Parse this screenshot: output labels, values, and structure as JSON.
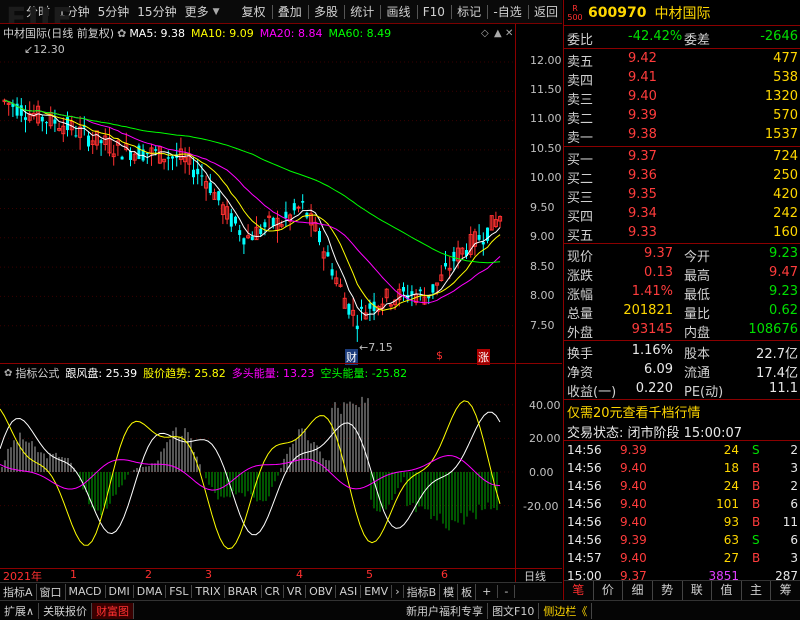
{
  "toolbar": {
    "items": [
      "分时",
      "1分钟",
      "5分钟",
      "15分钟",
      "更多",
      "复权",
      "叠加",
      "多股",
      "统计",
      "画线",
      "F10",
      "标记",
      "-自选",
      "返回"
    ]
  },
  "main_title": {
    "name": "中材国际(日线 前复权)",
    "ma5": "MA5: 9.38",
    "ma10": "MA10: 9.09",
    "ma20": "MA20: 8.84",
    "ma60": "MA60: 8.49"
  },
  "colors": {
    "ma5": "#ffffff",
    "ma10": "#ffff00",
    "ma20": "#ff00ff",
    "ma60": "#00ff00",
    "up": "#ff3030",
    "down": "#00ffff"
  },
  "price_axis": [
    "12.00",
    "11.50",
    "11.00",
    "10.50",
    "10.00",
    "9.50",
    "9.00",
    "8.50",
    "8.00",
    "7.50"
  ],
  "high_label": "12.30",
  "low_label": "7.15",
  "markers": {
    "cai": "财",
    "s": "$",
    "zhang": "涨"
  },
  "indicator": {
    "name": "指标公式",
    "a": "跟风盘: 25.39",
    "b": "股价趋势: 25.82",
    "c": "多头能量: 13.23",
    "d": "空头能量: -25.82"
  },
  "ind_axis": [
    "40.00",
    "20.00",
    "0.00",
    "-20.00"
  ],
  "dates": [
    "2021年",
    "1",
    "2",
    "3",
    "4",
    "5",
    "6"
  ],
  "date_right": "日线",
  "bottom_tabs": [
    "指标A",
    "窗口",
    "MACD",
    "DMI",
    "DMA",
    "FSL",
    "TRIX",
    "BRAR",
    "CR",
    "VR",
    "OBV",
    "ASI",
    "EMV",
    "指标B",
    "模",
    "板",
    "+",
    "-"
  ],
  "bottom2": [
    "扩展∧",
    "关联报价",
    "财富图",
    "新用户福利专享",
    "图文F10",
    "侧边栏《"
  ],
  "right": {
    "code": "600970",
    "name": "中材国际",
    "badge": "R",
    "badge2": "500",
    "weibi_lbl": "委比",
    "weibi": "-42.42%",
    "weicha_lbl": "委差",
    "weicha": "-2646",
    "asks": [
      {
        "l": "卖五",
        "p": "9.42",
        "v": "477"
      },
      {
        "l": "卖四",
        "p": "9.41",
        "v": "538"
      },
      {
        "l": "卖三",
        "p": "9.40",
        "v": "1320"
      },
      {
        "l": "卖二",
        "p": "9.39",
        "v": "570"
      },
      {
        "l": "卖一",
        "p": "9.38",
        "v": "1537"
      }
    ],
    "bids": [
      {
        "l": "买一",
        "p": "9.37",
        "v": "724"
      },
      {
        "l": "买二",
        "p": "9.36",
        "v": "250"
      },
      {
        "l": "买三",
        "p": "9.35",
        "v": "420"
      },
      {
        "l": "买四",
        "p": "9.34",
        "v": "242"
      },
      {
        "l": "买五",
        "p": "9.33",
        "v": "160"
      }
    ],
    "stats": [
      {
        "l1": "现价",
        "v1": "9.37",
        "c1": "red",
        "l2": "今开",
        "v2": "9.23",
        "c2": "grn"
      },
      {
        "l1": "涨跌",
        "v1": "0.13",
        "c1": "red",
        "l2": "最高",
        "v2": "9.47",
        "c2": "red"
      },
      {
        "l1": "涨幅",
        "v1": "1.41%",
        "c1": "red",
        "l2": "最低",
        "v2": "9.23",
        "c2": "grn"
      },
      {
        "l1": "总量",
        "v1": "201821",
        "c1": "yel",
        "l2": "量比",
        "v2": "0.62",
        "c2": "grn"
      },
      {
        "l1": "外盘",
        "v1": "93145",
        "c1": "red",
        "l2": "内盘",
        "v2": "108676",
        "c2": "grn"
      }
    ],
    "stats2": [
      {
        "l1": "换手",
        "v1": "1.16%",
        "l2": "股本",
        "v2": "22.7亿"
      },
      {
        "l1": "净资",
        "v1": "6.09",
        "l2": "流通",
        "v2": "17.4亿"
      },
      {
        "l1": "收益(一)",
        "v1": "0.220",
        "l2": "PE(动)",
        "v2": "11.1"
      }
    ],
    "promo": "仅需20元查看千档行情",
    "status": "交易状态: 闭市阶段 15:00:07",
    "ticks": [
      {
        "t": "14:56",
        "p": "9.39",
        "v": "24",
        "d": "S",
        "n": "2"
      },
      {
        "t": "14:56",
        "p": "9.40",
        "v": "18",
        "d": "B",
        "n": "3"
      },
      {
        "t": "14:56",
        "p": "9.40",
        "v": "24",
        "d": "B",
        "n": "2"
      },
      {
        "t": "14:56",
        "p": "9.40",
        "v": "101",
        "d": "B",
        "n": "6"
      },
      {
        "t": "14:56",
        "p": "9.40",
        "v": "93",
        "d": "B",
        "n": "11"
      },
      {
        "t": "14:56",
        "p": "9.39",
        "v": "63",
        "d": "S",
        "n": "6"
      },
      {
        "t": "14:57",
        "p": "9.40",
        "v": "27",
        "d": "B",
        "n": "3"
      },
      {
        "t": "15:00",
        "p": "9.37",
        "v": "3851",
        "d": "",
        "n": "287"
      }
    ],
    "tabs": [
      "笔",
      "价",
      "细",
      "势",
      "联",
      "值",
      "主",
      "筹"
    ]
  }
}
